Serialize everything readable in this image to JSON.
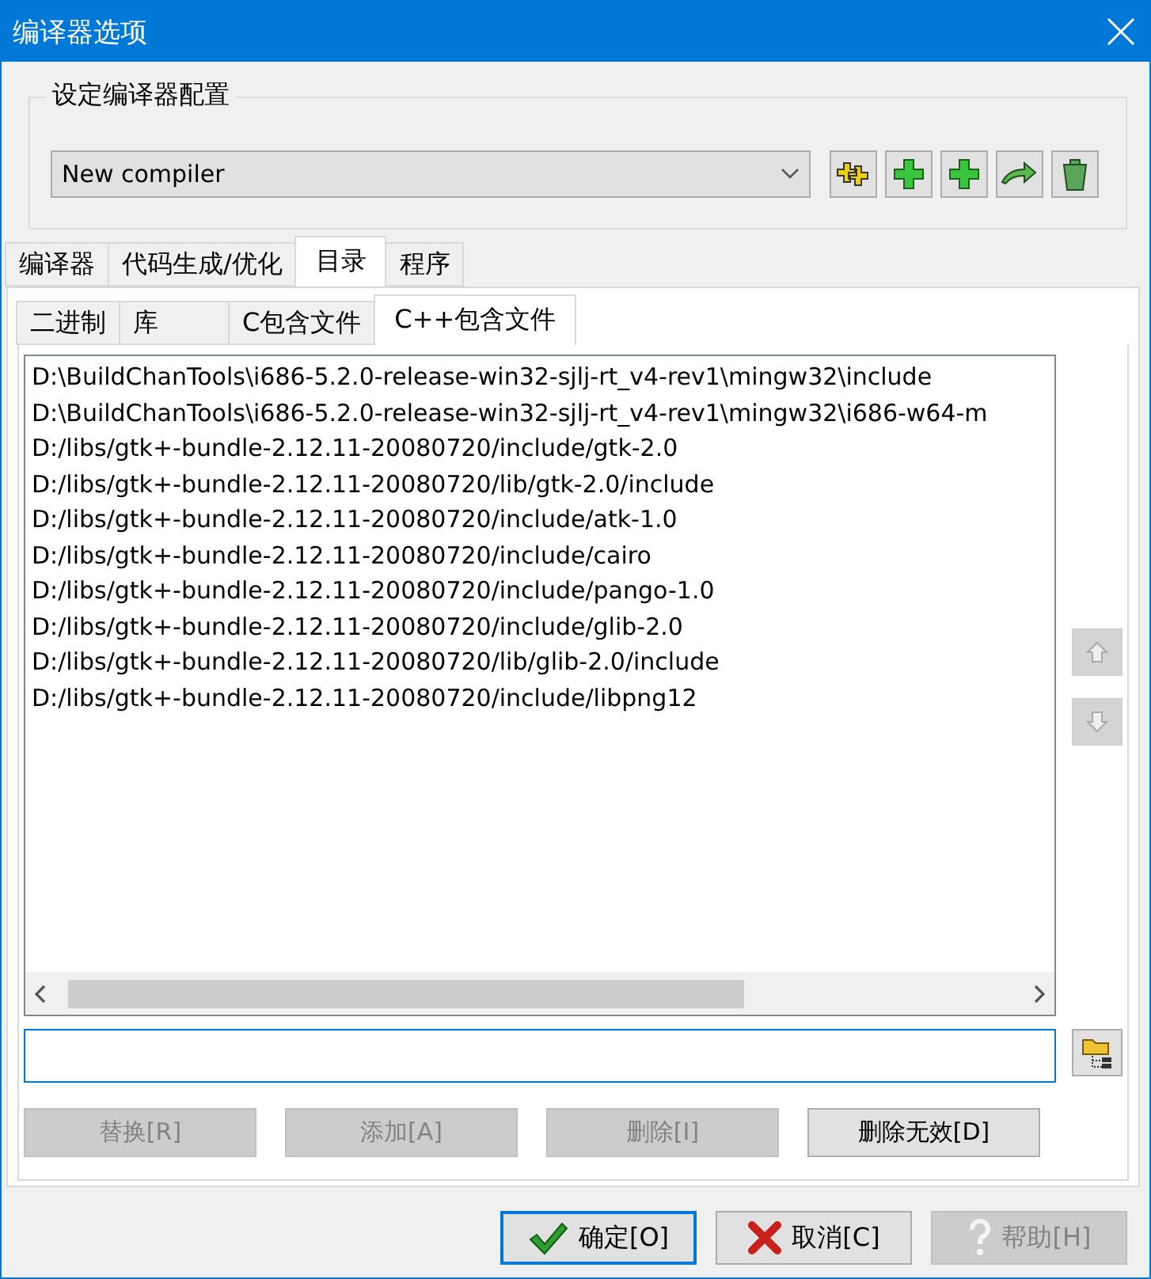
{
  "window": {
    "title": "编译器选项"
  },
  "compiler_set": {
    "label": "设定编译器配置",
    "value": "New compiler"
  },
  "tabs": [
    {
      "label": "编译器",
      "selected": false
    },
    {
      "label": "代码生成/优化",
      "selected": false
    },
    {
      "label": "目录",
      "selected": true
    },
    {
      "label": "程序",
      "selected": false
    }
  ],
  "subtabs": [
    {
      "label": "二进制",
      "selected": false
    },
    {
      "label": "库",
      "selected": false
    },
    {
      "label": "C包含文件",
      "selected": false
    },
    {
      "label": "C++包含文件",
      "selected": true
    }
  ],
  "directories": [
    "D:\\BuildChanTools\\i686-5.2.0-release-win32-sjlj-rt_v4-rev1\\mingw32\\include",
    "D:\\BuildChanTools\\i686-5.2.0-release-win32-sjlj-rt_v4-rev1\\mingw32\\i686-w64-m",
    "D:/libs/gtk+-bundle-2.12.11-20080720/include/gtk-2.0",
    "D:/libs/gtk+-bundle-2.12.11-20080720/lib/gtk-2.0/include",
    "D:/libs/gtk+-bundle-2.12.11-20080720/include/atk-1.0",
    "D:/libs/gtk+-bundle-2.12.11-20080720/include/cairo",
    "D:/libs/gtk+-bundle-2.12.11-20080720/include/pango-1.0",
    "D:/libs/gtk+-bundle-2.12.11-20080720/include/glib-2.0",
    "D:/libs/gtk+-bundle-2.12.11-20080720/lib/glib-2.0/include",
    "D:/libs/gtk+-bundle-2.12.11-20080720/include/libpng12"
  ],
  "actions": [
    {
      "label": "替换[R]",
      "disabled": true
    },
    {
      "label": "添加[A]",
      "disabled": true
    },
    {
      "label": "删除[I]",
      "disabled": true
    },
    {
      "label": "删除无效[D]",
      "disabled": false
    }
  ],
  "buttons": [
    {
      "kind": "ok",
      "label": "确定[O]",
      "disabled": false,
      "default": true
    },
    {
      "kind": "cancel",
      "label": "取消[C]",
      "disabled": false,
      "default": false
    },
    {
      "kind": "help",
      "label": "帮助[H]",
      "disabled": true,
      "default": false
    }
  ]
}
